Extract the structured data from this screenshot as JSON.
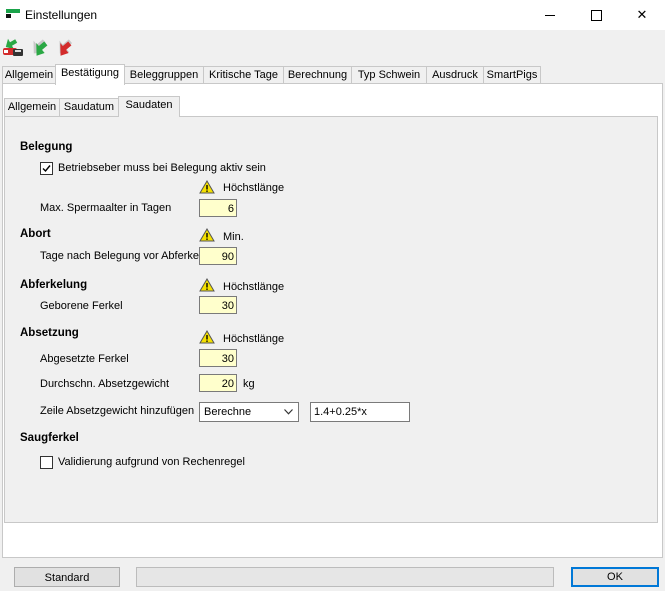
{
  "window": {
    "title": "Einstellungen",
    "controls": {
      "minimize": "",
      "maximize": "",
      "close": "✕"
    }
  },
  "colors": {
    "required_field_bg": "#ffffcc",
    "ok_border": "#0078d7",
    "warning_fill": "#f5e100",
    "arrow_green": "#2aa844",
    "arrow_red": "#d32b2b"
  },
  "toolbar": {
    "icons": [
      "save-transfer-icon",
      "forward-arrow-icon",
      "back-arrow-icon"
    ]
  },
  "main_tabs": [
    {
      "label": "Allgemein"
    },
    {
      "label": "Bestätigung"
    },
    {
      "label": "Beleggruppen"
    },
    {
      "label": "Kritische Tage"
    },
    {
      "label": "Berechnung"
    },
    {
      "label": "Typ Schwein"
    },
    {
      "label": "Ausdruck"
    },
    {
      "label": "SmartPigs"
    }
  ],
  "sub_tabs": [
    {
      "label": "Allgemein"
    },
    {
      "label": "Saudatum"
    },
    {
      "label": "Saudaten"
    }
  ],
  "belegung": {
    "title": "Belegung",
    "checkbox_label": "Betriebseber muss bei Belegung aktiv sein",
    "checkbox_checked": true,
    "warn_label": "Höchstlänge",
    "field_label": "Max. Spermaalter in Tagen",
    "field_value": "6"
  },
  "abort": {
    "title": "Abort",
    "warn_label": "Min.",
    "field_label": "Tage nach Belegung vor Abferkel",
    "field_value": "90"
  },
  "abferkelung": {
    "title": "Abferkelung",
    "warn_label": "Höchstlänge",
    "field_label": "Geborene Ferkel",
    "field_value": "30"
  },
  "absetzung": {
    "title": "Absetzung",
    "warn_label": "Höchstlänge",
    "abgesetzte_label": "Abgesetzte Ferkel",
    "abgesetzte_value": "30",
    "gewicht_label": "Durchschn. Absetzgewicht",
    "gewicht_value": "20",
    "gewicht_unit": "kg",
    "zeile_label": "Zeile Absetzgewicht hinzufügen",
    "zeile_select": "Berechne",
    "formula_value": "1.4+0.25*x"
  },
  "saugferkel": {
    "title": "Saugferkel",
    "checkbox_label": "Validierung aufgrund von Rechenregel",
    "checkbox_checked": false
  },
  "footer": {
    "standard_label": "Standard",
    "ok_label": "OK"
  }
}
